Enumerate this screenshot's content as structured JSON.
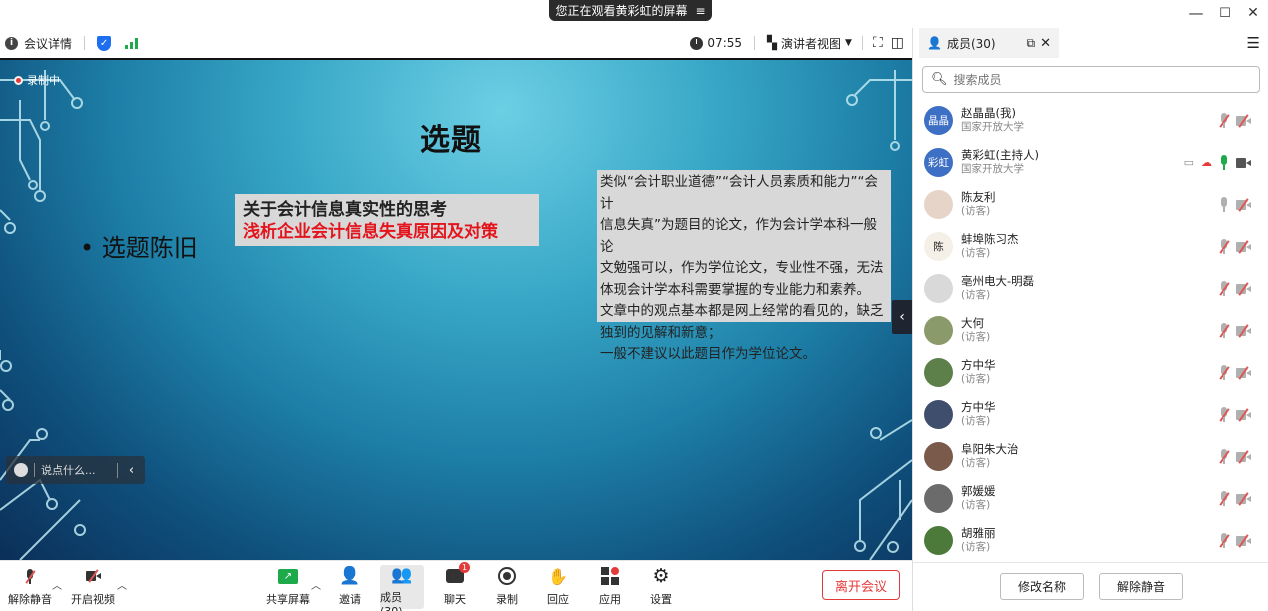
{
  "window": {
    "viewing_banner": "您正在观看黄彩虹的屏幕",
    "banner_icon": "menu-lines-icon",
    "minimize": "—",
    "maximize": "☐",
    "close": "✕"
  },
  "toolbar": {
    "meeting_details": "会议详情",
    "time": "07:55",
    "view_mode": "演讲者视图",
    "security_color": "#1e6ff0",
    "signal_color": "#1ea94a"
  },
  "screen": {
    "recording": "录制中",
    "slide_title": "选题",
    "bullet": "• 选题陈旧",
    "box_mid_line1": "关于会计信息真实性的思考",
    "box_mid_line2": "浅析企业会计信息失真原因及对策",
    "box_right_lines": [
      "类似“会计职业道德”“会计人员素质和能力”“会计",
      "信息失真”为题目的论文，作为会计学本科一般论",
      "文勉强可以，作为学位论文，专业性不强，无法",
      "体现会计学本科需要掌握的专业能力和素养。",
      "文章中的观点基本都是网上经常的看见的，缺乏",
      "独到的见解和新意；",
      "一般不建议以此题目作为学位论文。"
    ],
    "chat_placeholder": "说点什么...",
    "chat_chevron": "‹",
    "collapse": "‹"
  },
  "bottombar": {
    "unmute": "解除静音",
    "start_video": "开启视频",
    "share_screen": "共享屏幕",
    "invite": "邀请",
    "members": "成员(30)",
    "chat": "聊天",
    "chat_badge": "1",
    "record": "录制",
    "reactions": "回应",
    "apps": "应用",
    "settings": "设置",
    "leave": "离开会议",
    "leave_color": "#e53a3a"
  },
  "panel": {
    "tab_label": "成员(30)",
    "search_placeholder": "搜索成员",
    "members": [
      {
        "name": "赵晶晶(我)",
        "sub": "国家开放大学",
        "avatar_text": "晶晶",
        "avatar_color": "#3d6fc4",
        "mic": "muted",
        "cam": "off"
      },
      {
        "name": "黄彩虹(主持人)",
        "sub": "国家开放大学",
        "avatar_text": "彩虹",
        "avatar_color": "#3d6fc4",
        "mic": "on",
        "cam": "on"
      },
      {
        "name": "陈友利",
        "sub": "(访客)",
        "avatar_text": "",
        "avatar_color": "#e6d4c8",
        "mic": "idle",
        "cam": "off"
      },
      {
        "name": "蚌埠陈习杰",
        "sub": "(访客)",
        "avatar_text": "陈",
        "avatar_color": "#f4f0e8",
        "mic": "muted",
        "cam": "off"
      },
      {
        "name": "亳州电大-明磊",
        "sub": "(访客)",
        "avatar_text": "",
        "avatar_color": "#d9d9d9",
        "mic": "muted",
        "cam": "off"
      },
      {
        "name": "大何",
        "sub": "(访客)",
        "avatar_text": "",
        "avatar_color": "#8a9a6a",
        "mic": "muted",
        "cam": "off"
      },
      {
        "name": "方中华",
        "sub": "(访客)",
        "avatar_text": "",
        "avatar_color": "#5d7f4a",
        "mic": "muted",
        "cam": "off"
      },
      {
        "name": "方中华",
        "sub": "(访客)",
        "avatar_text": "",
        "avatar_color": "#3f4e6c",
        "mic": "muted",
        "cam": "off"
      },
      {
        "name": "阜阳朱大治",
        "sub": "(访客)",
        "avatar_text": "",
        "avatar_color": "#7a5a4a",
        "mic": "muted",
        "cam": "off"
      },
      {
        "name": "郭媛媛",
        "sub": "(访客)",
        "avatar_text": "",
        "avatar_color": "#6b6b6b",
        "mic": "muted",
        "cam": "off"
      },
      {
        "name": "胡雅丽",
        "sub": "(访客)",
        "avatar_text": "",
        "avatar_color": "#4c7a3a",
        "mic": "muted",
        "cam": "off"
      }
    ],
    "rename": "修改名称",
    "unmute": "解除静音"
  }
}
